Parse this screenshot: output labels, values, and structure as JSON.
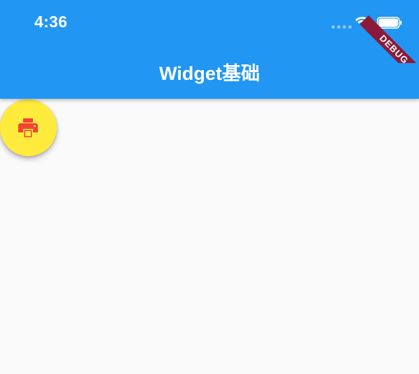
{
  "status_bar": {
    "time": "4:36",
    "signal_icon": "signal-dots-icon",
    "wifi_icon": "wifi-icon",
    "battery_icon": "battery-icon"
  },
  "app_bar": {
    "title": "Widget基础",
    "color": "#2196f3"
  },
  "fab": {
    "icon": "print-icon",
    "background_color": "#ffeb3b",
    "icon_color": "#f44336"
  },
  "debug_banner": {
    "label": "DEBUG",
    "color": "#8b1a3a"
  },
  "body": {
    "background_color": "#fafafa"
  }
}
